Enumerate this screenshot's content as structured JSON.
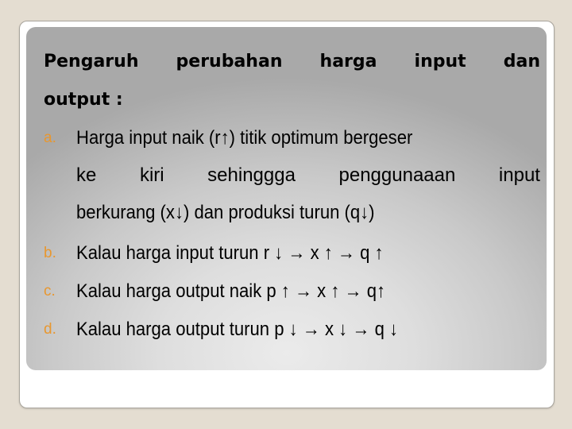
{
  "slide": {
    "title": {
      "line1_words": [
        "Pengaruh",
        "perubahan",
        "harga",
        "input",
        "dan"
      ],
      "line2": "output :"
    },
    "items": [
      {
        "marker": "a.",
        "lines": [
          "Harga input naik (r↑) titik optimum bergeser",
          [
            "ke",
            "kiri",
            "sehinggga",
            "penggunaaan",
            "input"
          ],
          "berkurang (x↓) dan produksi turun (q↓)"
        ]
      },
      {
        "marker": "b.",
        "text": "Kalau harga input turun r ↓ → x ↑ → q ↑"
      },
      {
        "marker": "c.",
        "text": "Kalau harga output naik p ↑ → x ↑ → q↑"
      },
      {
        "marker": "d.",
        "text": "Kalau harga output turun p ↓ → x ↓ → q ↓"
      }
    ],
    "colors": {
      "background": "#e4ddd1",
      "card": "#ffffff",
      "panel_center": "#ebebeb",
      "panel_edge": "#a9a9a9",
      "marker": "#e8972f",
      "text": "#000000"
    }
  }
}
